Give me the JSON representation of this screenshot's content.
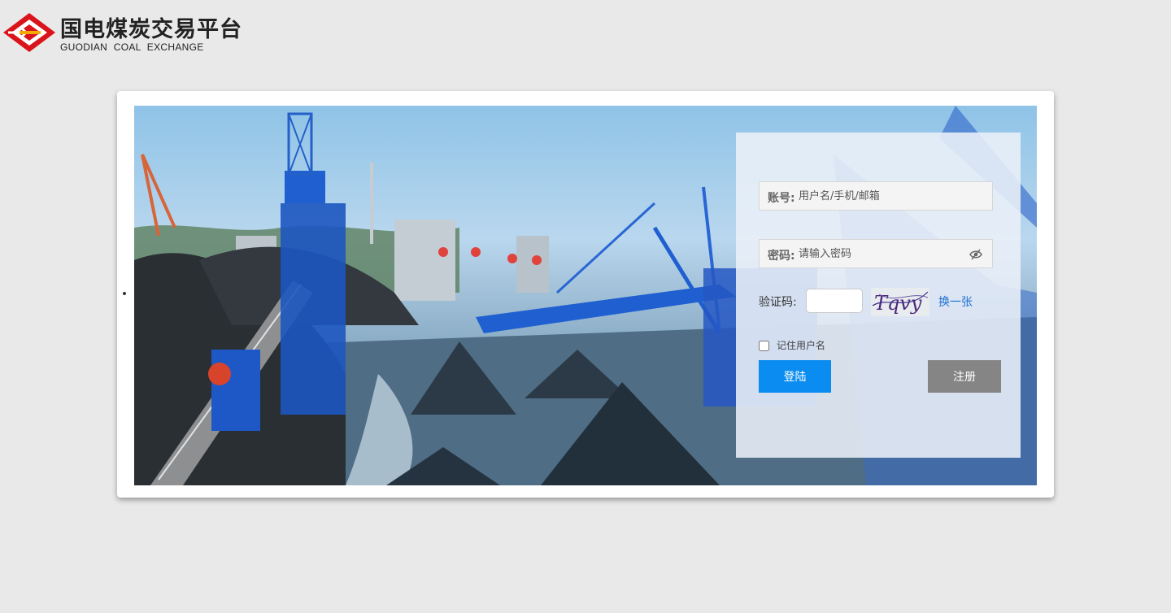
{
  "header": {
    "brand_cn": "国电煤炭交易平台",
    "brand_en": "GUODIAN COAL EXCHANGE",
    "logo_icon": "guodian-diamond-logo"
  },
  "login": {
    "account_label": "账号:",
    "account_placeholder": "用户名/手机/邮箱",
    "password_label": "密码:",
    "password_placeholder": "请输入密码",
    "password_toggle_icon": "eye-slash-icon",
    "captcha_label": "验证码:",
    "captcha_value": "",
    "captcha_text": "Tqvy",
    "refresh_label": "换一张",
    "remember_label": "记住用户名",
    "remember_checked": false,
    "login_button": "登陆",
    "register_button": "注册"
  },
  "colors": {
    "page_bg": "#e9e9e9",
    "login_button": "#0a8cf0",
    "register_button": "#858585",
    "link": "#1f6fd1",
    "logo_red": "#d9141b"
  }
}
